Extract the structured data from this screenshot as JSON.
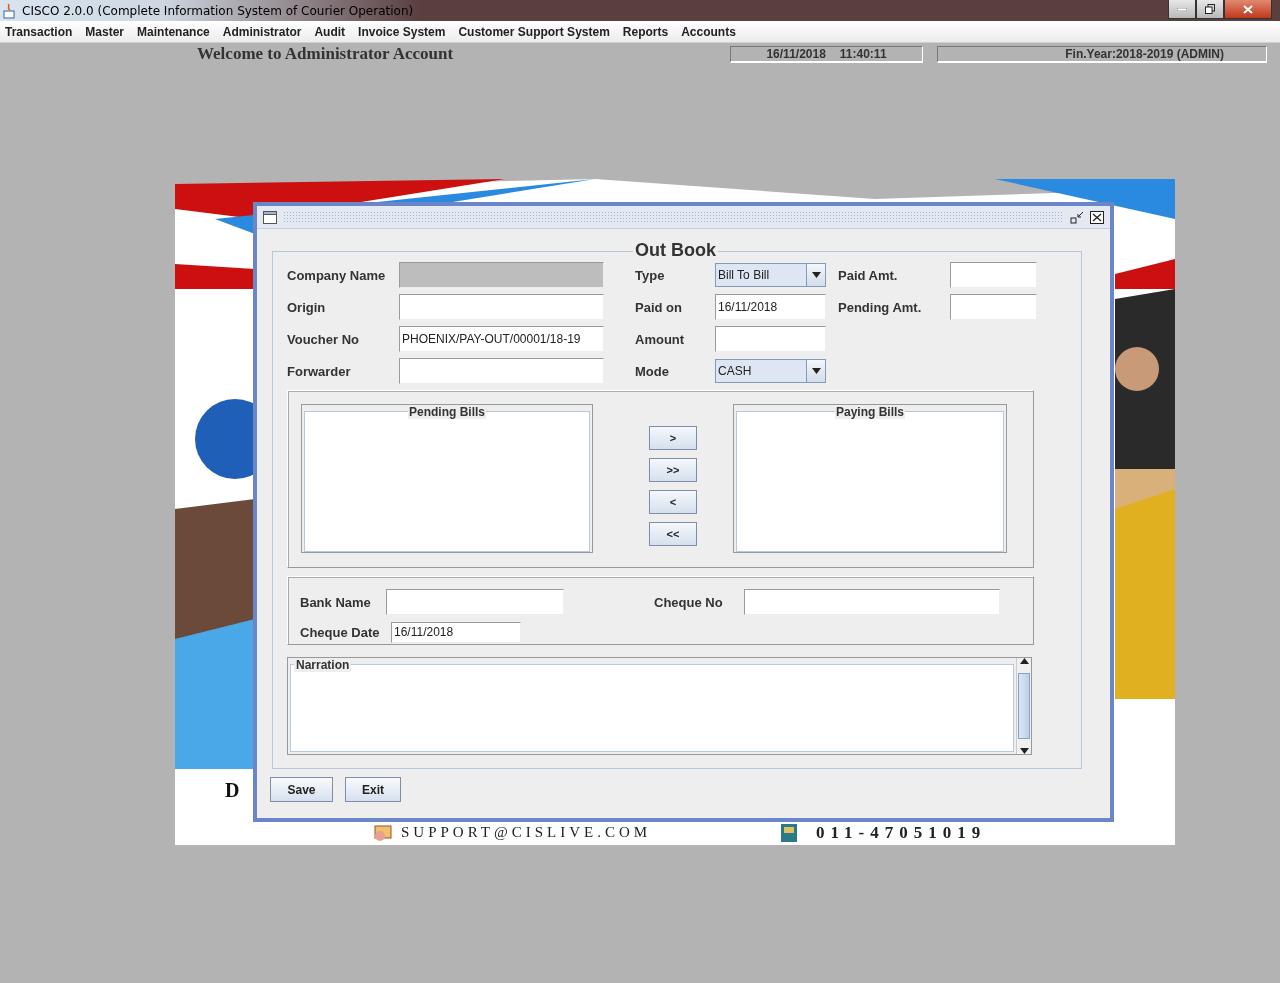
{
  "app": {
    "title": "CISCO 2.0.0 (Complete Information System of Courier Operation)"
  },
  "menu": [
    {
      "label": "Transaction"
    },
    {
      "label": "Master"
    },
    {
      "label": "Maintenance"
    },
    {
      "label": "Administrator"
    },
    {
      "label": "Audit"
    },
    {
      "label": "Invoice System"
    },
    {
      "label": "Customer Support System"
    },
    {
      "label": "Reports"
    },
    {
      "label": "Accounts"
    }
  ],
  "header": {
    "welcome": "Welcome to Administrator Account",
    "date": "16/11/2018",
    "time": "11:40:11",
    "fin_year": "Fin.Year:2018-2019  (ADMIN)"
  },
  "poster": {
    "kind": "picture",
    "side_text": "D",
    "email": "SUPPORT@CISLIVE.COM",
    "phone": "011-47051019"
  },
  "dialog": {
    "title": "Out Book",
    "rows": [
      [
        {
          "label": "Company Name",
          "kind": "text",
          "disabled": true
        },
        {
          "label": "Type",
          "kind": "combo",
          "value": "Bill To Bill"
        },
        {
          "label": "Paid Amt.",
          "kind": "text",
          "disabled": false
        }
      ],
      [
        {
          "label": "Origin",
          "kind": "text",
          "disabled": false
        },
        {
          "label": "Paid on",
          "kind": "text",
          "value": "16/11/2018",
          "disabled": false
        },
        {
          "label": "Pending Amt.",
          "kind": "text",
          "disabled": false
        }
      ],
      [
        {
          "label": "Voucher No",
          "kind": "text",
          "value": "PHOENIX/PAY-OUT/00001/18-19",
          "disabled": false
        },
        {
          "label": "Amount",
          "kind": "text",
          "disabled": false
        }
      ],
      [
        {
          "label": "Forwarder",
          "kind": "text",
          "disabled": false
        },
        {
          "label": "Mode",
          "kind": "combo",
          "value": "CASH"
        }
      ]
    ],
    "pending_bills": {
      "title": "Pending Bills"
    },
    "paying_bills": {
      "title": "Paying Bills"
    },
    "transfer_buttons": [
      ">",
      ">>",
      "<",
      "<<"
    ],
    "bank": {
      "bank_name": {
        "label": "Bank Name"
      },
      "cheque_no": {
        "label": "Cheque No"
      },
      "cheque_date": {
        "label": "Cheque Date",
        "value": "16/11/2018"
      }
    },
    "narration": {
      "label": "Narration"
    },
    "buttons": [
      "Save",
      "Exit"
    ]
  }
}
